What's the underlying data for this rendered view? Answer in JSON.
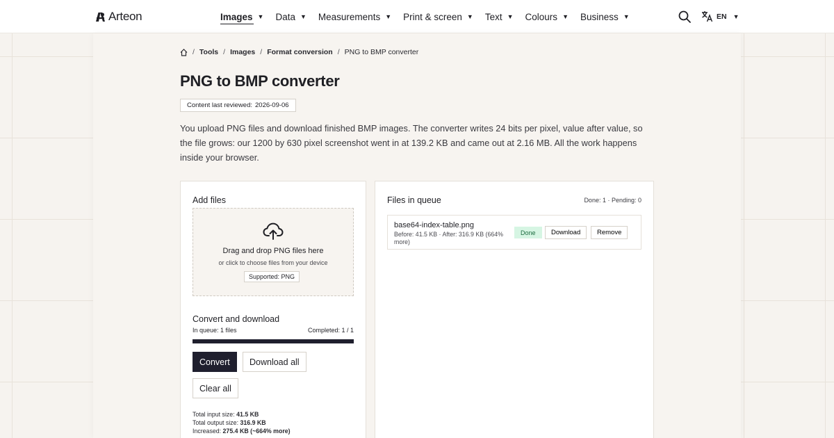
{
  "header": {
    "brand": "Arteon",
    "nav": [
      {
        "label": "Images",
        "active": true
      },
      {
        "label": "Data"
      },
      {
        "label": "Measurements"
      },
      {
        "label": "Print & screen"
      },
      {
        "label": "Text"
      },
      {
        "label": "Colours"
      },
      {
        "label": "Business"
      }
    ],
    "language": "EN",
    "icons": {
      "search": "search-icon",
      "language": "translate-icon",
      "home": "home-icon"
    }
  },
  "breadcrumb": {
    "items": [
      "Tools",
      "Images",
      "Format conversion"
    ],
    "current": "PNG to BMP converter"
  },
  "page": {
    "title": "PNG to BMP converter",
    "review_label": "Content last reviewed:",
    "review_date": "2026-09-06",
    "intro": "You upload PNG files and download finished BMP images. The converter writes 24 bits per pixel, value after value, so the file grows: our 1200 by 630 pixel screenshot went in at 139.2 KB and came out at 2.16 MB. All the work happens inside your browser."
  },
  "add_files": {
    "title": "Add files",
    "dropzone": {
      "title": "Drag and drop PNG files here",
      "subtitle": "or click to choose files from your device",
      "supported": "Supported: PNG"
    },
    "convert_section_title": "Convert and download",
    "in_queue": "In queue: 1 files",
    "completed": "Completed: 1 / 1",
    "progress": 1.0,
    "buttons": {
      "convert": "Convert",
      "download_all": "Download all",
      "clear_all": "Clear all"
    },
    "totals": {
      "input_label": "Total input size:",
      "input_value": "41.5 KB",
      "output_label": "Total output size:",
      "output_value": "316.9 KB",
      "increased_label": "Increased:",
      "increased_value": "275.4 KB (~664% more)"
    }
  },
  "queue": {
    "title": "Files in queue",
    "counts": "Done: 1 · Pending: 0",
    "files": [
      {
        "name": "base64-index-table.png",
        "meta": "Before: 41.5 KB · After: 316.9 KB (664% more)",
        "status": "Done",
        "download_label": "Download",
        "remove_label": "Remove"
      }
    ]
  },
  "colors": {
    "accent": "#1f1f2e",
    "done_bg": "#d6f5e3",
    "done_text": "#1b6b3f",
    "page_bg": "#f6f3ef"
  }
}
